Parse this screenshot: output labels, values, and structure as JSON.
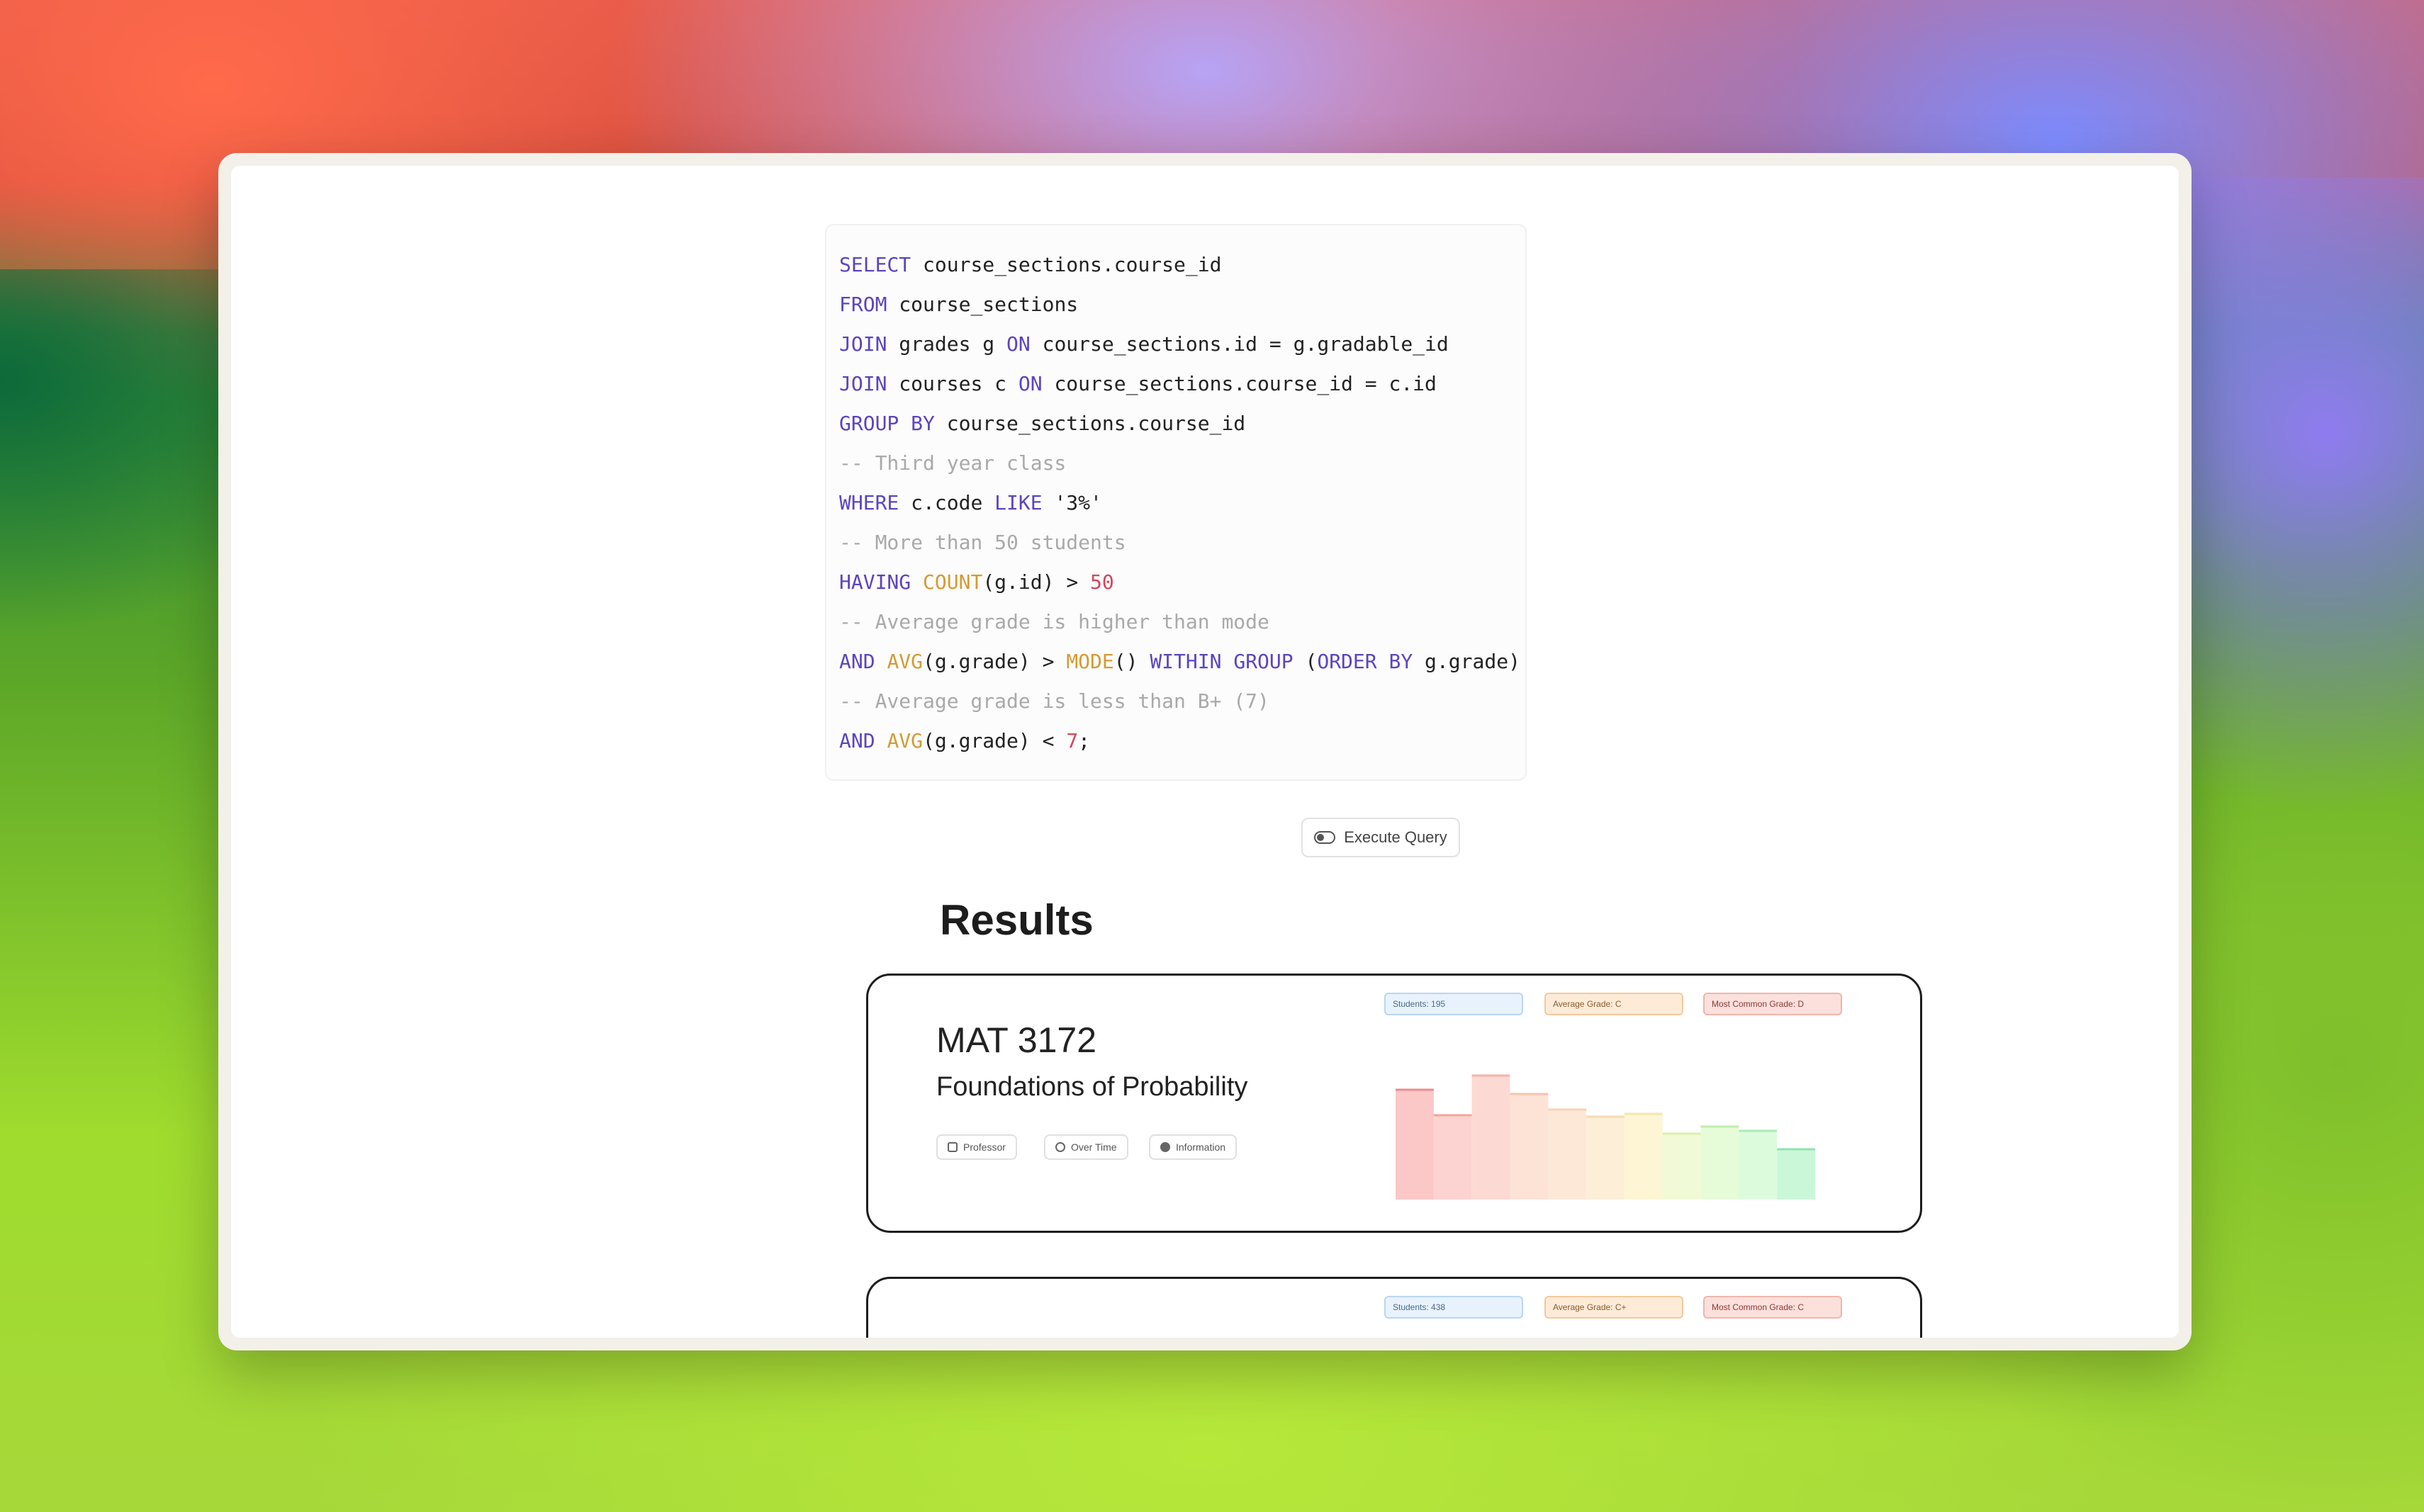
{
  "query": {
    "lines": [
      [
        {
          "t": "SELECT",
          "c": "kw"
        },
        {
          "t": " course_sections.course_id",
          "c": "str"
        }
      ],
      [
        {
          "t": "FROM",
          "c": "kw"
        },
        {
          "t": " course_sections",
          "c": "str"
        }
      ],
      [
        {
          "t": "JOIN",
          "c": "kw"
        },
        {
          "t": " grades g ",
          "c": "str"
        },
        {
          "t": "ON",
          "c": "kw"
        },
        {
          "t": " course_sections.id = g.gradable_id",
          "c": "str"
        }
      ],
      [
        {
          "t": "JOIN",
          "c": "kw"
        },
        {
          "t": " courses c ",
          "c": "str"
        },
        {
          "t": "ON",
          "c": "kw"
        },
        {
          "t": " course_sections.course_id = c.id",
          "c": "str"
        }
      ],
      [
        {
          "t": "GROUP BY",
          "c": "kw"
        },
        {
          "t": " course_sections.course_id",
          "c": "str"
        }
      ],
      [
        {
          "t": "-- Third year class",
          "c": "cm"
        }
      ],
      [
        {
          "t": "WHERE",
          "c": "kw"
        },
        {
          "t": " c.code ",
          "c": "str"
        },
        {
          "t": "LIKE",
          "c": "kw"
        },
        {
          "t": " '3%'",
          "c": "str"
        }
      ],
      [
        {
          "t": "-- More than 50 students",
          "c": "cm"
        }
      ],
      [
        {
          "t": "HAVING",
          "c": "kw"
        },
        {
          "t": " ",
          "c": "str"
        },
        {
          "t": "COUNT",
          "c": "fn"
        },
        {
          "t": "(g.id) > ",
          "c": "str"
        },
        {
          "t": "50",
          "c": "num"
        }
      ],
      [
        {
          "t": "-- Average grade is higher than mode",
          "c": "cm"
        }
      ],
      [
        {
          "t": "AND",
          "c": "kw"
        },
        {
          "t": " ",
          "c": "str"
        },
        {
          "t": "AVG",
          "c": "fn"
        },
        {
          "t": "(g.grade) > ",
          "c": "str"
        },
        {
          "t": "MODE",
          "c": "fn"
        },
        {
          "t": "() ",
          "c": "str"
        },
        {
          "t": "WITHIN GROUP",
          "c": "kw"
        },
        {
          "t": " (",
          "c": "str"
        },
        {
          "t": "ORDER BY",
          "c": "kw"
        },
        {
          "t": " g.grade)",
          "c": "str"
        }
      ],
      [
        {
          "t": "-- Average grade is less than B+ (7)",
          "c": "cm"
        }
      ],
      [
        {
          "t": "AND",
          "c": "kw"
        },
        {
          "t": " ",
          "c": "str"
        },
        {
          "t": "AVG",
          "c": "fn"
        },
        {
          "t": "(g.grade) < ",
          "c": "str"
        },
        {
          "t": "7",
          "c": "num"
        },
        {
          "t": ";",
          "c": "str"
        }
      ]
    ]
  },
  "execute_label": "Execute Query",
  "results_title": "Results",
  "cards": [
    {
      "code": "MAT 3172",
      "name": "Foundations of Probability",
      "students": "Students: 195",
      "average": "Average Grade: C",
      "mode": "Most Common Grade: D",
      "chips": [
        "Professor",
        "Over Time",
        "Information"
      ],
      "distribution": [
        78,
        60,
        88,
        75,
        64,
        59,
        61,
        47,
        52,
        49,
        36
      ],
      "colors": [
        "#fbc7c7",
        "#fcd3d0",
        "#fdd9d3",
        "#fde2d6",
        "#fde8d8",
        "#fdeed8",
        "#fdf5d4",
        "#f1fad6",
        "#e6fbd8",
        "#dcfbdc",
        "#cbf7d9"
      ],
      "strokes": [
        "#f28c8c",
        "#f5a49e",
        "#f7b2a4",
        "#f8c3ab",
        "#f7d2b2",
        "#f5dcb2",
        "#f2e8a8",
        "#d9f1a8",
        "#bfeeae",
        "#a9ebb5",
        "#8fe3b0"
      ]
    },
    {
      "students": "Students: 438",
      "average": "Average Grade: C+",
      "mode": "Most Common Grade: C"
    }
  ]
}
